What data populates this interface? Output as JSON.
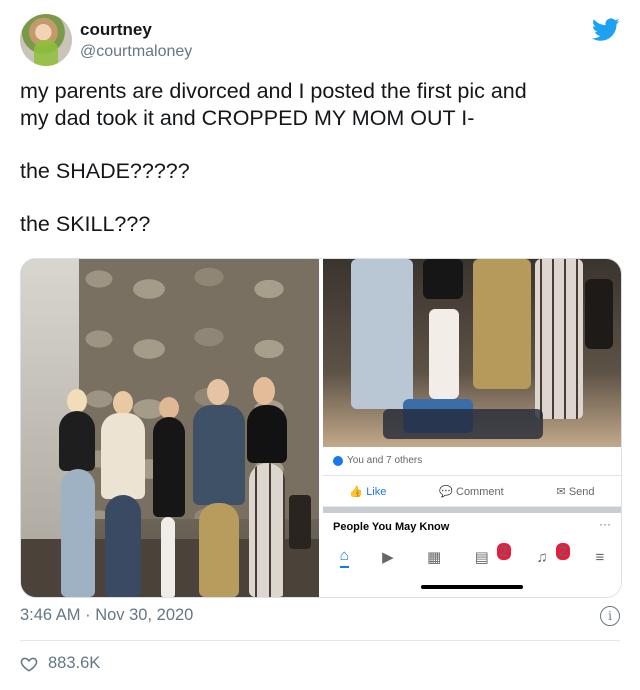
{
  "author": {
    "name": "courtney",
    "handle": "@courtmaloney"
  },
  "tweet": {
    "lines": [
      "my parents are divorced and I posted the first pic and",
      "my dad took it and CROPPED MY MOM OUT I-",
      "the SHADE?????",
      "the SKILL???"
    ],
    "timestamp": "3:46 AM · Nov 30, 2020",
    "likes": "883.6K"
  },
  "facebook": {
    "reactions": "You and 7 others",
    "actions": {
      "like": "Like",
      "comment": "Comment",
      "send": "Send"
    },
    "people_heading": "People You May Know",
    "more": "···",
    "nav": [
      {
        "icon": "home-icon",
        "glyph": "⌂",
        "badge": ""
      },
      {
        "icon": "video-icon",
        "glyph": "▶",
        "badge": ""
      },
      {
        "icon": "marketplace-icon",
        "glyph": "▦",
        "badge": ""
      },
      {
        "icon": "news-icon",
        "glyph": "▤",
        "badge": "2"
      },
      {
        "icon": "notifications-icon",
        "glyph": "♫",
        "badge": "2"
      },
      {
        "icon": "menu-icon",
        "glyph": "≡",
        "badge": ""
      }
    ]
  },
  "colors": {
    "twitter_blue": "#1da1f2",
    "facebook_blue": "#1877f2",
    "secondary_text": "#657786"
  }
}
